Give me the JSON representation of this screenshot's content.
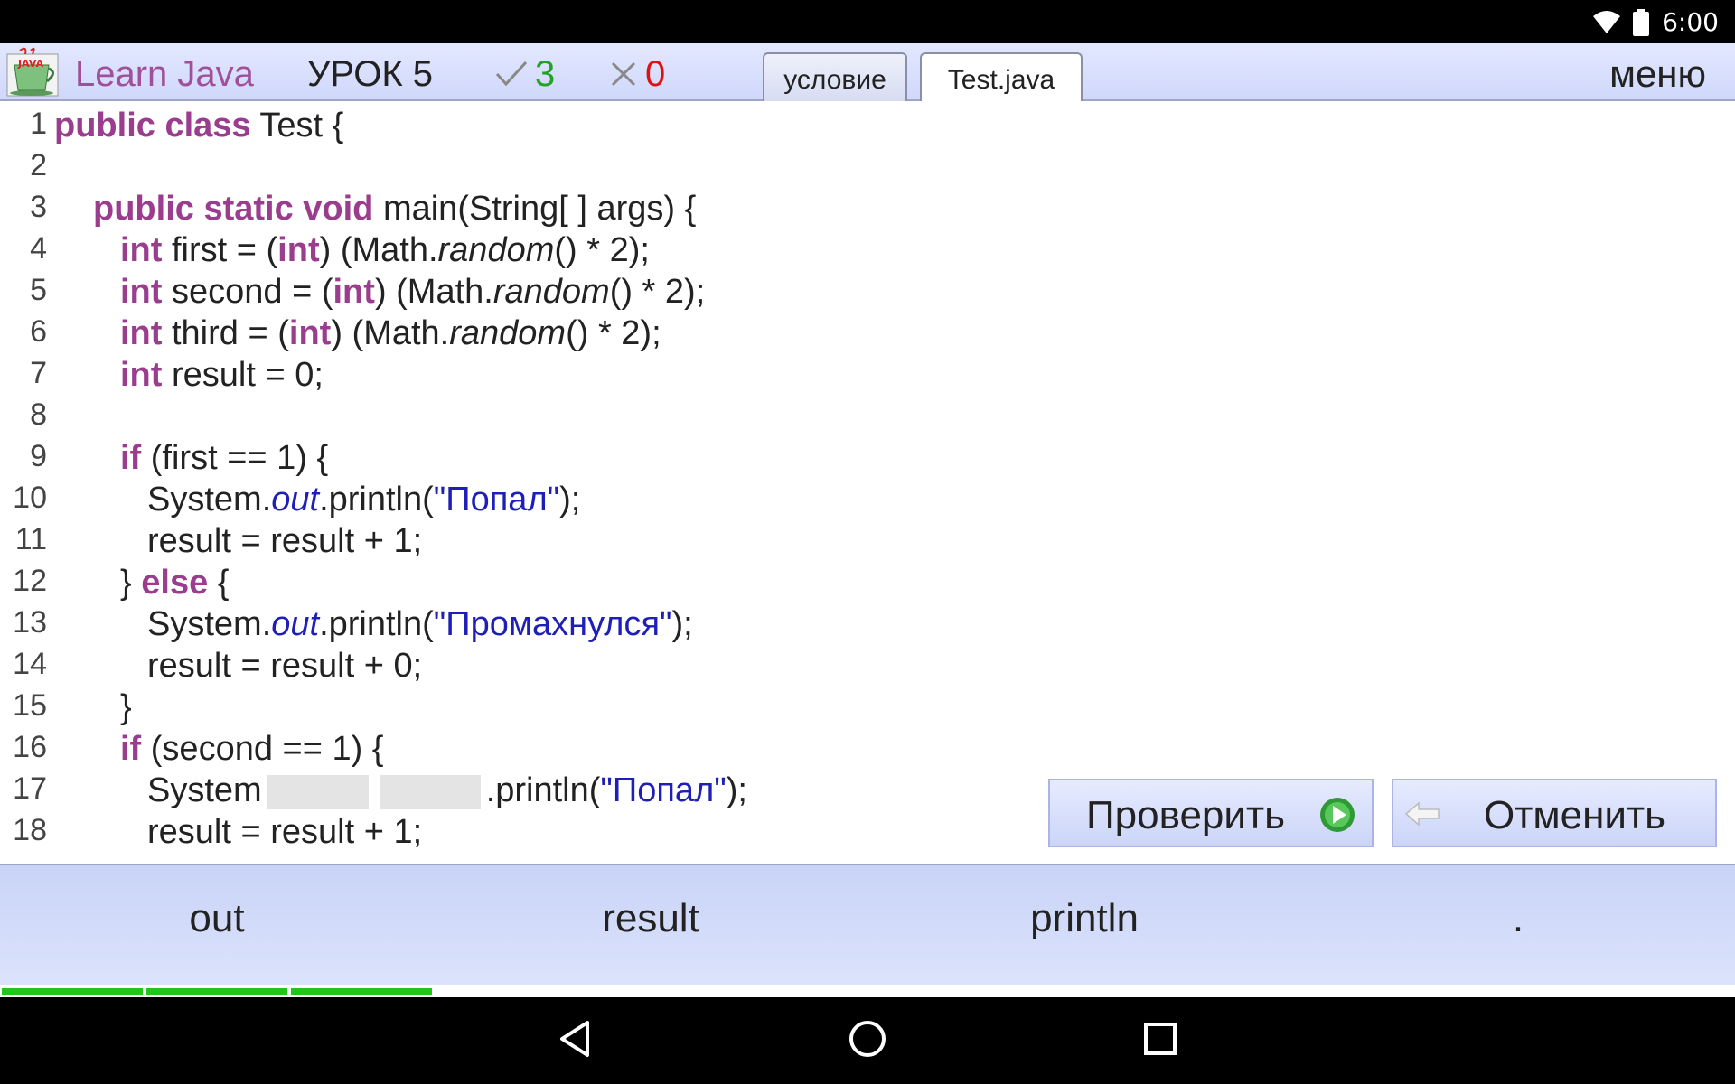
{
  "status_bar": {
    "time": "6:00"
  },
  "app_bar": {
    "logo_text": "JAVA",
    "title": "Learn Java",
    "lesson": "УРОК 5",
    "correct_count": "3",
    "wrong_count": "0",
    "tabs": [
      {
        "label": "условие",
        "active": false
      },
      {
        "label": "Test.java",
        "active": true
      }
    ],
    "menu_label": "меню"
  },
  "code_lines": [
    {
      "n": "1"
    },
    {
      "n": "2"
    },
    {
      "n": "3"
    },
    {
      "n": "4"
    },
    {
      "n": "5"
    },
    {
      "n": "6"
    },
    {
      "n": "7"
    },
    {
      "n": "8"
    },
    {
      "n": "9"
    },
    {
      "n": "10"
    },
    {
      "n": "11"
    },
    {
      "n": "12"
    },
    {
      "n": "13"
    },
    {
      "n": "14"
    },
    {
      "n": "15"
    },
    {
      "n": "16"
    },
    {
      "n": "17"
    },
    {
      "n": "18"
    }
  ],
  "code": {
    "l1": {
      "kw": "public class",
      "rest": " Test {"
    },
    "l3": {
      "kw": "public static void",
      "rest": " main(String[ ] args) {"
    },
    "l4": {
      "kw1": "int",
      "a": " first = (",
      "kw2": "int",
      "b": ") (Math.",
      "fn": "random",
      "c": "() * 2);"
    },
    "l5": {
      "kw1": "int",
      "a": " second = (",
      "kw2": "int",
      "b": ") (Math.",
      "fn": "random",
      "c": "() * 2);"
    },
    "l6": {
      "kw1": "int",
      "a": " third = (",
      "kw2": "int",
      "b": ") (Math.",
      "fn": "random",
      "c": "() * 2);"
    },
    "l7": {
      "kw": "int",
      "rest": " result = 0;"
    },
    "l9": {
      "kw": "if",
      "rest": " (first == 1) {"
    },
    "l10": {
      "a": "System.",
      "field": "out",
      "b": ".println(",
      "str": "\"Попал\"",
      "c": ");"
    },
    "l11": {
      "text": "result = result + 1;"
    },
    "l12": {
      "a": "} ",
      "kw": "else",
      "b": " {"
    },
    "l13": {
      "a": "System.",
      "field": "out",
      "b": ".println(",
      "str": "\"Промахнулся\"",
      "c": ");"
    },
    "l14": {
      "text": "result = result + 0;"
    },
    "l15": {
      "text": "}"
    },
    "l16": {
      "kw": "if",
      "rest": " (second == 1) {"
    },
    "l17": {
      "a": "System",
      "b": ".println(",
      "str": "\"Попал\"",
      "c": ");"
    },
    "l18": {
      "text": "result = result + 1;"
    }
  },
  "buttons": {
    "check": "Проверить",
    "cancel": "Отменить"
  },
  "word_choices": [
    "out",
    "result",
    "println",
    "."
  ],
  "progress": {
    "segments_done": 3,
    "segments_total": 12
  },
  "colors": {
    "keyword": "#9a3d8e",
    "string": "#1f1fb8",
    "correct": "#23a326",
    "wrong": "#e01010",
    "progress": "#22c41e"
  }
}
